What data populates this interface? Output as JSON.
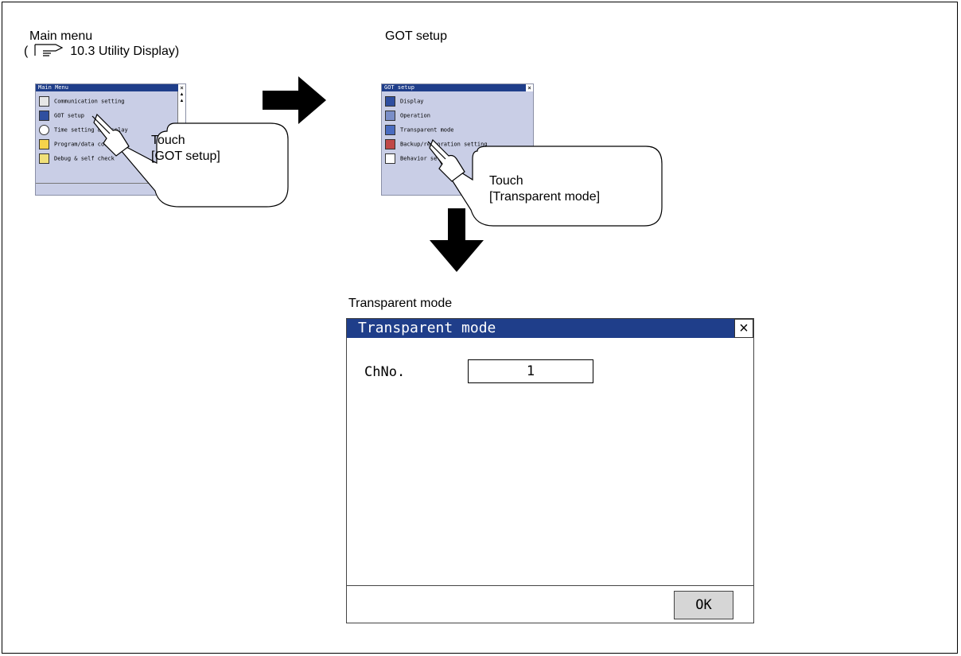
{
  "captions": {
    "main_menu": "Main menu",
    "reference": "10.3 Utility Display)",
    "reference_open": "(",
    "got_setup": "GOT setup",
    "transparent_mode": "Transparent mode"
  },
  "main_menu_screen": {
    "title": "Main Menu",
    "close": "×",
    "items": [
      "Communication setting",
      "GOT setup",
      "Time setting & display",
      "Program/data control",
      "Debug & self check"
    ]
  },
  "got_setup_screen": {
    "title": "GOT setup",
    "close": "×",
    "items": [
      "Display",
      "Operation",
      "Transparent mode",
      "Backup/restoration setting",
      "Behavior setting"
    ]
  },
  "callouts": {
    "touch_got": {
      "line1": "Touch",
      "line2": "[GOT setup]"
    },
    "touch_transparent": {
      "line1": "Touch",
      "line2": "[Transparent mode]"
    }
  },
  "dialog": {
    "title": "Transparent mode",
    "close": "×",
    "ch_label": "ChNo.",
    "ch_value": "1",
    "ok_label": "OK"
  },
  "colors": {
    "title_bar": "#1f3e8a",
    "screen_bg": "#c9cee6",
    "button_bg": "#d6d6d6"
  }
}
